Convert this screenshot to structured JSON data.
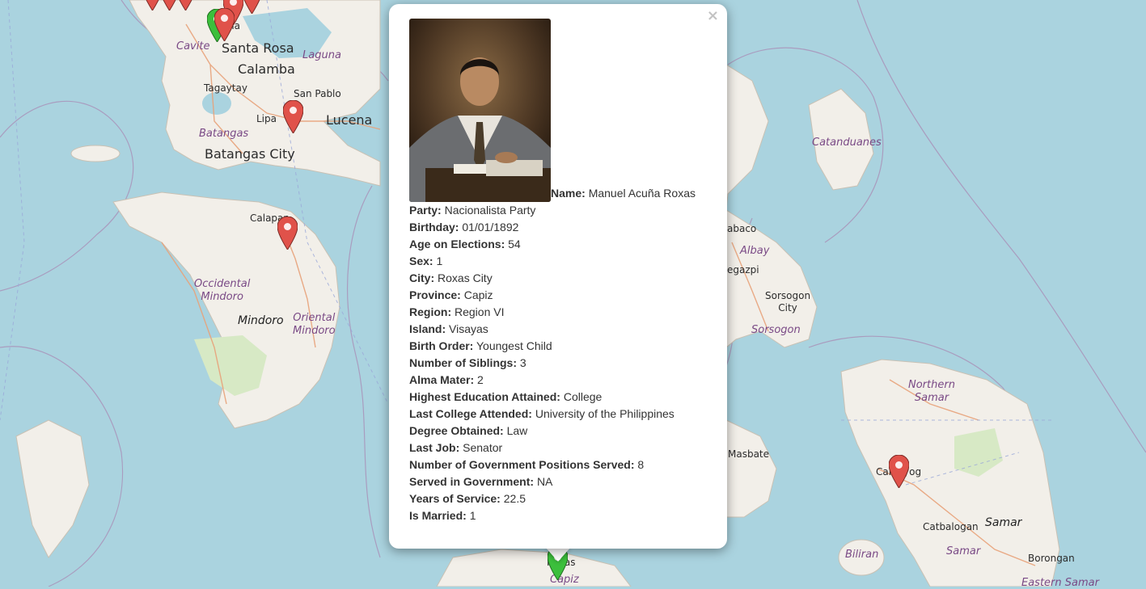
{
  "map": {
    "labels": {
      "santa_rosa": "Santa Rosa",
      "calamba": "Calamba",
      "cavite": "Cavite",
      "laguna": "Laguna",
      "tagaytay": "Tagaytay",
      "san_pablo": "San Pablo",
      "lipa": "Lipa",
      "lucena": "Lucena",
      "batangas": "Batangas",
      "batangas_city": "Batangas City",
      "calapan": "Calapan",
      "occidental_mindoro": [
        "Occidental",
        "Mindoro"
      ],
      "oriental_mindoro": [
        "Oriental",
        "Mindoro"
      ],
      "mindoro": "Mindoro",
      "catanduanes": "Catanduanes",
      "tabaco": "abaco",
      "albay": "Albay",
      "legazpi": "egazpi",
      "sorsogon_city": [
        "Sorsogon",
        "City"
      ],
      "sorsogon": "Sorsogon",
      "masbate": "Masbate",
      "northern_samar": [
        "Northern",
        "Samar"
      ],
      "calbayog": "Calbayog",
      "catbalogan": "Catbalogan",
      "samar_island": "Samar",
      "samar_prov": "Samar",
      "biliran": "Biliran",
      "borongan": "Borongan",
      "eastern_samar": "Eastern Samar",
      "roxas": "Roxas",
      "capiz": "Capiz",
      "manila_partial": "ila"
    }
  },
  "popup": {
    "close_label": "×",
    "portrait_alt": "Manuel Acuña Roxas portrait",
    "name_label": "Name:",
    "name_value": "Manuel Acuña Roxas",
    "fields": [
      {
        "label": "Party:",
        "value": "Nacionalista Party"
      },
      {
        "label": "Birthday:",
        "value": "01/01/1892"
      },
      {
        "label": "Age on Elections:",
        "value": "54"
      },
      {
        "label": "Sex:",
        "value": "1"
      },
      {
        "label": "City:",
        "value": "Roxas City"
      },
      {
        "label": "Province:",
        "value": "Capiz"
      },
      {
        "label": "Region:",
        "value": "Region VI"
      },
      {
        "label": "Island:",
        "value": "Visayas"
      },
      {
        "label": "Birth Order:",
        "value": "Youngest Child"
      },
      {
        "label": "Number of Siblings:",
        "value": "3"
      },
      {
        "label": "Alma Mater:",
        "value": "2"
      },
      {
        "label": "Highest Education Attained:",
        "value": "College"
      },
      {
        "label": "Last College Attended:",
        "value": "University of the Philippines"
      },
      {
        "label": "Degree Obtained:",
        "value": "Law"
      },
      {
        "label": "Last Job:",
        "value": "Senator"
      },
      {
        "label": "Number of Government Positions Served:",
        "value": "8"
      },
      {
        "label": "Served in Government:",
        "value": "NA"
      },
      {
        "label": "Years of Service:",
        "value": "22.5"
      },
      {
        "label": "Is Married:",
        "value": "1"
      }
    ]
  },
  "colors": {
    "water": "#aad3df",
    "land": "#f2efe9",
    "park": "#c8e6b0",
    "marker_red": "#e0524a",
    "marker_green": "#3cbf3c"
  }
}
